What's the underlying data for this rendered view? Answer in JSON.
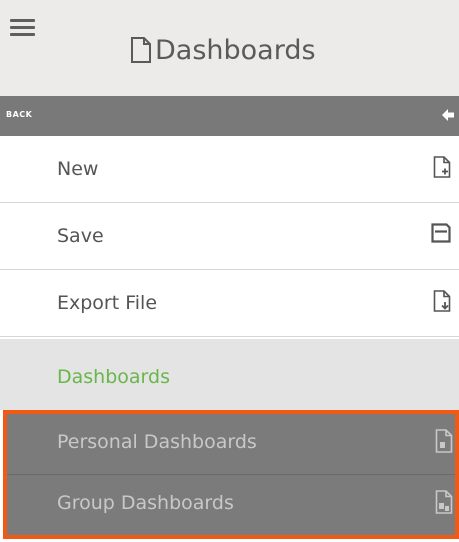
{
  "header": {
    "title": "Dashboards",
    "title_icon": "document-icon",
    "menu_icon": "hamburger-menu-icon"
  },
  "back_bar": {
    "label": "BACK",
    "icon": "arrow-left-icon"
  },
  "menu": {
    "items": [
      {
        "label": "New",
        "icon": "new-file-icon"
      },
      {
        "label": "Save",
        "icon": "save-icon"
      },
      {
        "label": "Export File",
        "icon": "export-file-icon"
      }
    ]
  },
  "section": {
    "label": "Dashboards",
    "items": [
      {
        "label": "Personal Dashboards",
        "icon": "personal-dashboard-icon"
      },
      {
        "label": "Group Dashboards",
        "icon": "group-dashboard-icon"
      }
    ]
  },
  "colors": {
    "header_bg": "#ecebea",
    "back_bar_bg": "#797979",
    "section_label": "#69b64a",
    "highlight_border": "#f05a14",
    "sub_menu_bg": "#7b7b7b"
  }
}
